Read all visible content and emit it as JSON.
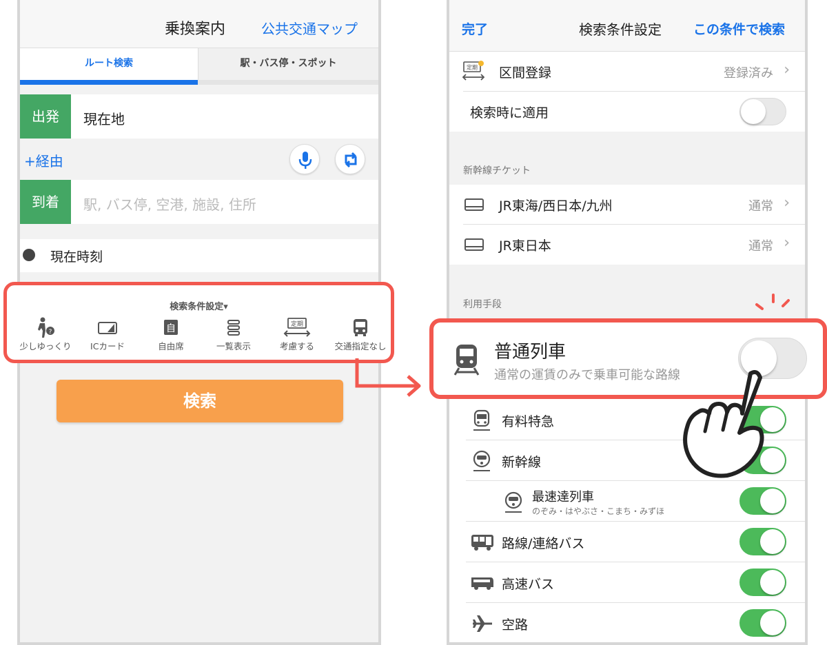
{
  "left": {
    "header": {
      "title": "乗換案内",
      "link": "公共交通マップ"
    },
    "tabs": [
      {
        "label": "ルート検索",
        "active": true
      },
      {
        "label": "駅・バス停・スポット",
        "active": false
      }
    ],
    "from": {
      "tag": "出発",
      "value": "現在地"
    },
    "via": "+経由",
    "to": {
      "tag": "到着",
      "placeholder": "駅, バス停, 空港, 施設, 住所"
    },
    "time": "現在時刻",
    "options": {
      "title": "検索条件設定▾",
      "items": [
        {
          "label": "少しゆっくり",
          "icon": "walker-icon"
        },
        {
          "label": "ICカード",
          "icon": "ic-card-icon"
        },
        {
          "label": "自由席",
          "icon": "seat-icon"
        },
        {
          "label": "一覧表示",
          "icon": "list-icon"
        },
        {
          "label": "考慮する",
          "icon": "commuter-pass-icon",
          "badge": "定期"
        },
        {
          "label": "交通指定なし",
          "icon": "bus-icon"
        }
      ]
    },
    "search_button": "検索"
  },
  "right": {
    "header": {
      "done": "完了",
      "title": "検索条件設定",
      "search": "この条件で検索"
    },
    "commuter": {
      "label": "区間登録",
      "value": "登録済み",
      "badge": "定期"
    },
    "apply": {
      "label": "検索時に適用",
      "on": false
    },
    "shinkansen_section": "新幹線チケット",
    "tickets": [
      {
        "label": "JR東海/西日本/九州",
        "value": "通常"
      },
      {
        "label": "JR東日本",
        "value": "通常"
      }
    ],
    "transport_section": "利用手段",
    "highlight": {
      "title": "普通列車",
      "subtitle": "通常の運賃のみで乗車可能な路線",
      "on": false
    },
    "modes": [
      {
        "label": "有料特急",
        "icon": "train-icon",
        "on": true
      },
      {
        "label": "新幹線",
        "icon": "shinkansen-icon",
        "on": true
      },
      {
        "label": "最速達列車",
        "sub": "のぞみ・はやぶさ・こまち・みずほ",
        "icon": "shinkansen-icon",
        "on": true
      },
      {
        "label": "路線/連絡バス",
        "icon": "bus-icon",
        "on": true
      },
      {
        "label": "高速バス",
        "icon": "highway-bus-icon",
        "on": true
      },
      {
        "label": "空路",
        "icon": "airplane-icon",
        "on": true
      }
    ]
  },
  "colors": {
    "accent": "#1a73e8",
    "green": "#44a764",
    "toggle_on": "#4cba5a",
    "orange": "#f8a04c",
    "highlight": "#f2584f"
  }
}
